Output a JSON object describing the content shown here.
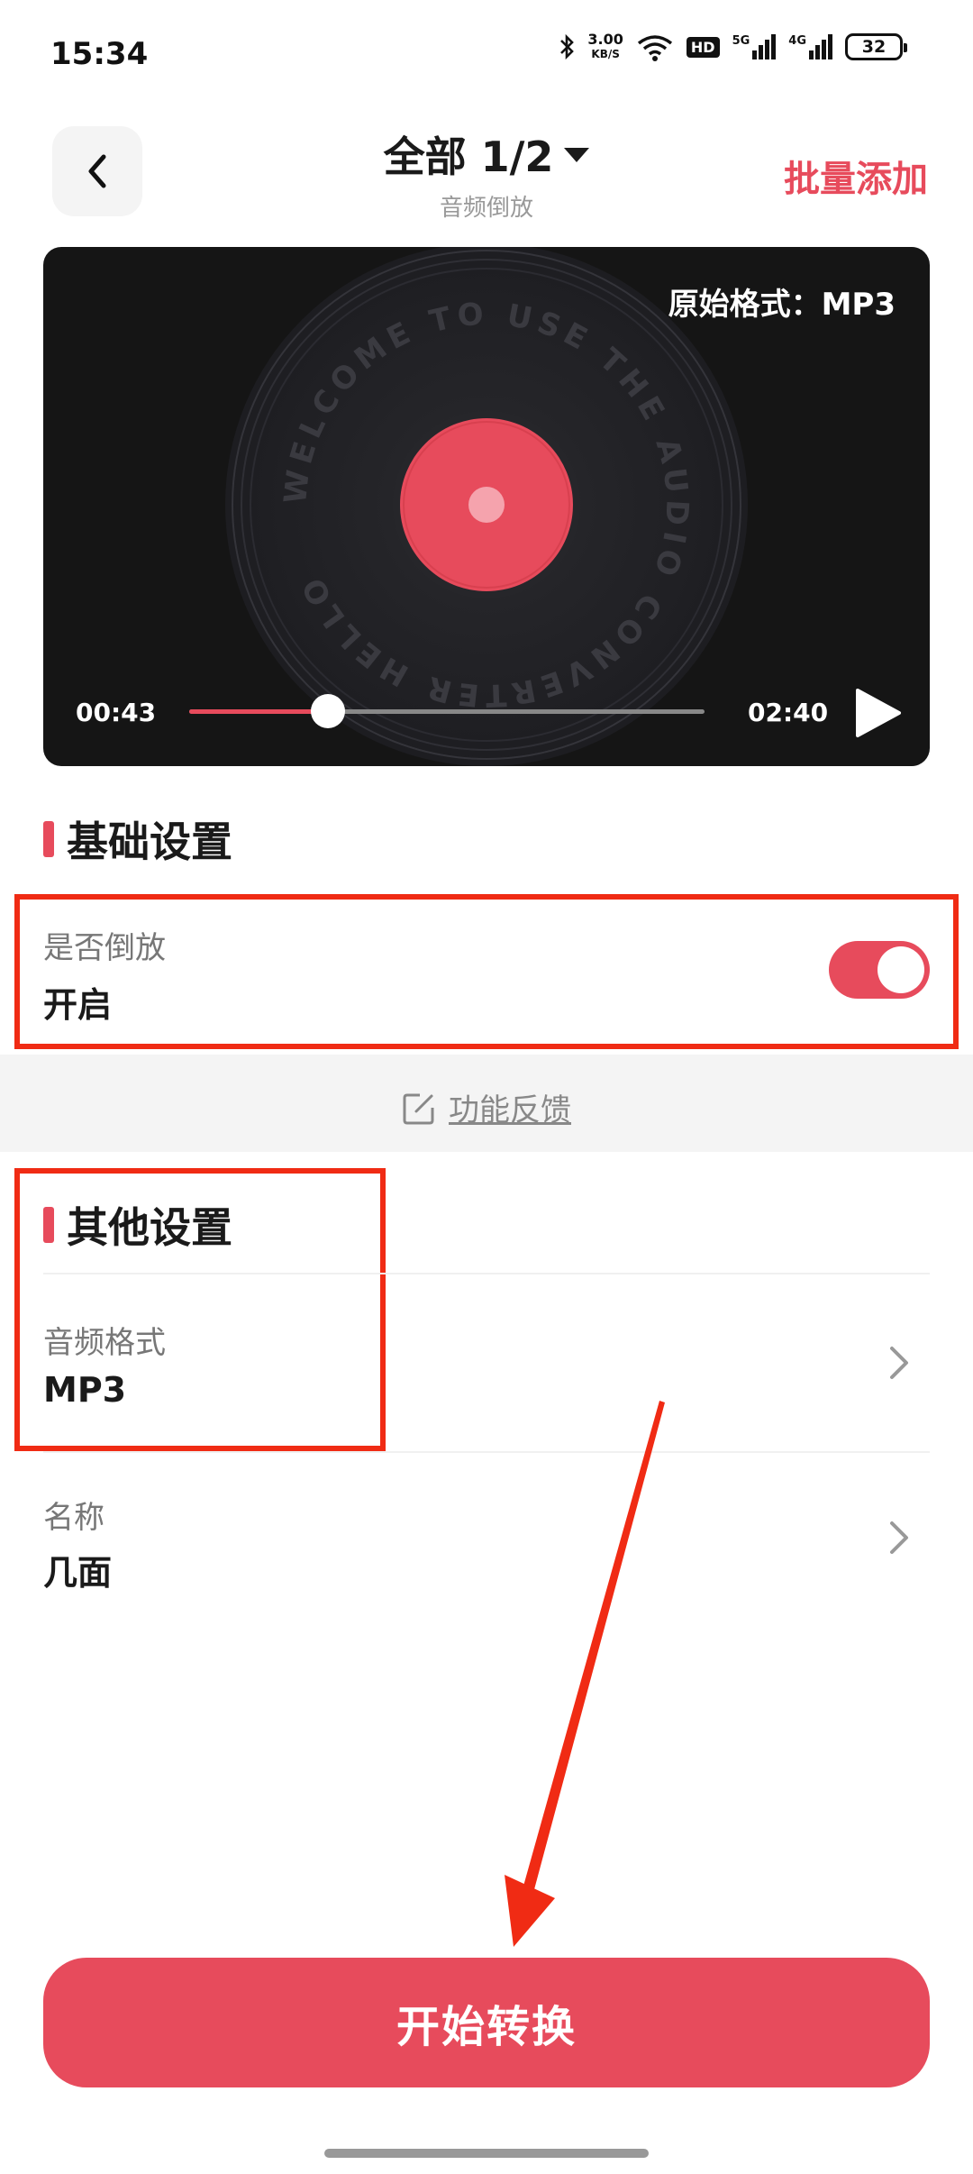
{
  "status": {
    "time": "15:34",
    "net_speed_value": "3.00",
    "net_speed_unit": "KB/S",
    "hd_badge": "HD",
    "sig1_tag": "5G",
    "sig2_tag": "4G",
    "battery": "32"
  },
  "header": {
    "title": "全部 1/2",
    "subtitle": "音频倒放",
    "batch_add": "批量添加"
  },
  "player": {
    "original_format": "原始格式：MP3",
    "current_time": "00:43",
    "total_time": "02:40",
    "progress": 0.27,
    "disc_text": "WELCOME TO USE THE AUDIO CONVERTER HELLO",
    "accent_color": "#e74b5c"
  },
  "basic_settings": {
    "title": "基础设置",
    "reverse": {
      "label": "是否倒放",
      "value": "开启",
      "enabled": true
    }
  },
  "feedback": {
    "label": "功能反馈"
  },
  "other_settings": {
    "title": "其他设置",
    "audio_format": {
      "label": "音频格式",
      "value": "MP3"
    },
    "name": {
      "label": "名称",
      "value": "几面"
    }
  },
  "actions": {
    "start_convert": "开始转换"
  }
}
